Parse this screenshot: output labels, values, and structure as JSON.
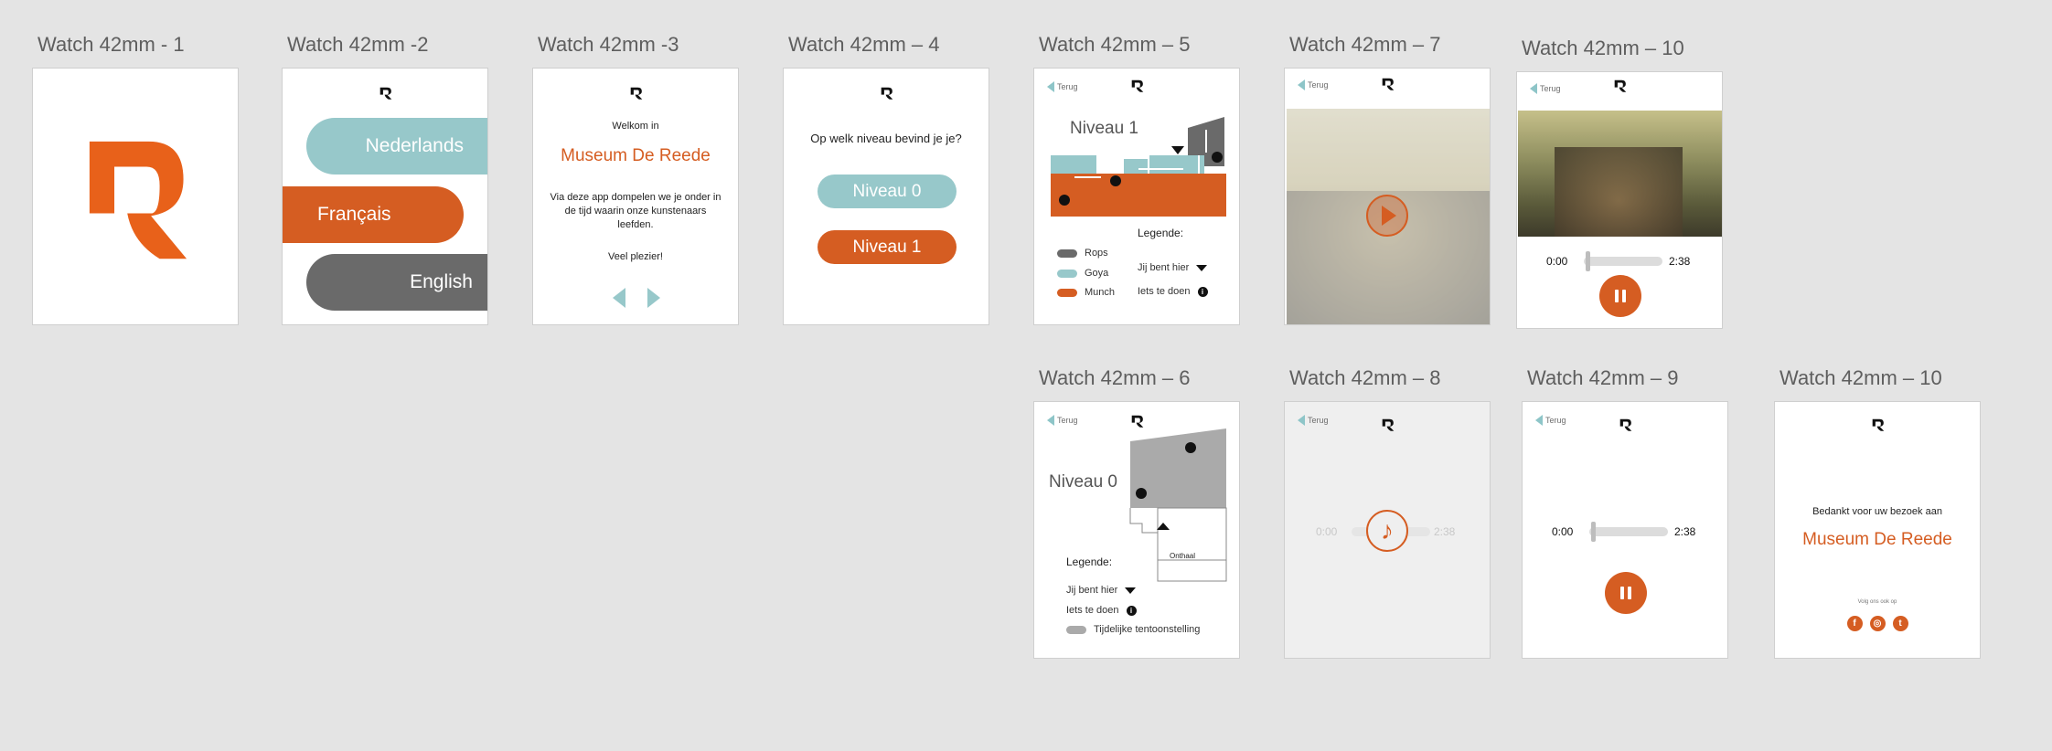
{
  "colors": {
    "orange": "#d55d22",
    "teal": "#97c8ca",
    "gray": "#6a6a6a",
    "canvas": "#e4e4e4"
  },
  "icons": {
    "logo": "r-logo-icon",
    "back": "back-arrow-icon",
    "info": "info-icon",
    "here": "you-are-here-icon",
    "play": "play-icon",
    "pause": "pause-icon",
    "music": "music-note-icon"
  },
  "boards": {
    "b1": {
      "title": "Watch 42mm - 1"
    },
    "b2": {
      "title": "Watch 42mm -2",
      "lang_nl": "Nederlands",
      "lang_fr": "Français",
      "lang_en": "English"
    },
    "b3": {
      "title": "Watch 42mm -3",
      "welcome": "Welkom in",
      "museum": "Museum De Reede",
      "intro": "Via deze app dompelen we je onder in de tijd waarin onze kunstenaars leefden.",
      "enjoy": "Veel plezier!"
    },
    "b4": {
      "title": "Watch 42mm – 4",
      "question": "Op welk niveau bevind je je?",
      "level0": "Niveau 0",
      "level1": "Niveau 1"
    },
    "b5": {
      "title": "Watch 42mm – 5",
      "back": "Terug",
      "level": "Niveau 1",
      "legend": "Legende:",
      "rops": "Rops",
      "goya": "Goya",
      "munch": "Munch",
      "here": "Jij bent hier",
      "todo": "Iets te doen"
    },
    "b7": {
      "title": "Watch 42mm – 7",
      "back": "Terug"
    },
    "b10a": {
      "title": "Watch 42mm – 10",
      "back": "Terug",
      "start": "0:00",
      "end": "2:38"
    },
    "b6": {
      "title": "Watch 42mm – 6",
      "back": "Terug",
      "level": "Niveau 0",
      "legend": "Legende:",
      "here": "Jij bent hier",
      "todo": "Iets te doen",
      "temp": "Tijdelijke tentoonstelling",
      "reception": "Onthaal"
    },
    "b8": {
      "title": "Watch 42mm – 8",
      "back": "Terug",
      "start": "0:00",
      "end": "2:38"
    },
    "b9": {
      "title": "Watch 42mm – 9",
      "back": "Terug",
      "start": "0:00",
      "end": "2:38"
    },
    "b10b": {
      "title": "Watch 42mm  – 10",
      "thanks": "Bedankt voor uw bezoek aan",
      "museum": "Museum De Reede",
      "follow": "Volg ons ook op",
      "social": [
        "f",
        "◎",
        "t"
      ]
    }
  },
  "player": {
    "progress": 0.04
  }
}
